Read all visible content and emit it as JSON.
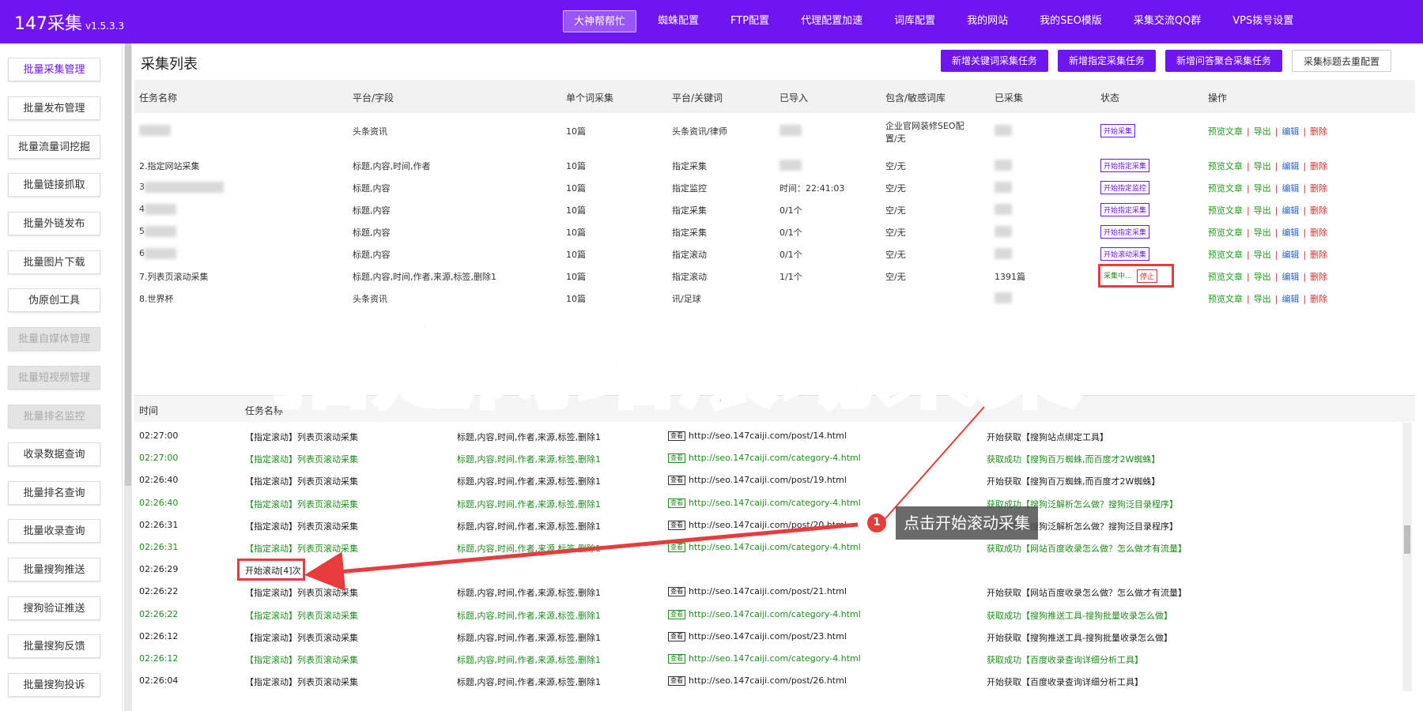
{
  "app": {
    "name": "147采集",
    "version": "v1.5.3.3"
  },
  "topnav": [
    "大神帮帮忙",
    "蜘蛛配置",
    "FTP配置",
    "代理配置加速",
    "词库配置",
    "我的网站",
    "我的SEO模版",
    "采集交流QQ群",
    "VPS拨号设置"
  ],
  "sidebar": [
    "批量采集管理",
    "批量发布管理",
    "批量流量词挖掘",
    "批量链接抓取",
    "批量外链发布",
    "批量图片下载",
    "伪原创工具",
    "批量自媒体管理",
    "批量短视频管理",
    "批量排名监控",
    "收录数据查询",
    "批量排名查询",
    "批量收录查询",
    "批量搜狗推送",
    "搜狗验证推送",
    "批量搜狗反馈",
    "批量搜狗投诉"
  ],
  "page": {
    "title": "采集列表"
  },
  "actions": [
    "新增关键词采集任务",
    "新增指定采集任务",
    "新增问答聚合采集任务",
    "采集标题去重配置"
  ],
  "table": {
    "headers": [
      "任务名称",
      "平台/字段",
      "单个词采集",
      "平台/关键词",
      "已导入",
      "包含/敏感词库",
      "已采集",
      "状态",
      "操作"
    ],
    "ops": [
      "预览文章",
      "导出",
      "编辑",
      "删除"
    ],
    "rows": [
      {
        "name": "",
        "fields": "头条资讯",
        "per": "10篇",
        "kw": "头条资讯/律师",
        "imported": "",
        "lib": "企业官网装修SEO配",
        "lib2": "置/无",
        "collected": "",
        "status": "开始采集"
      },
      {
        "name": "2.指定网站采集",
        "fields": "标题,内容,时间,作者",
        "per": "10篇",
        "kw": "指定采集",
        "imported": "",
        "lib": "空/无",
        "collected": "",
        "status": "开始指定采集"
      },
      {
        "name": "3",
        "fields": "标题,内容",
        "per": "10篇",
        "kw": "指定监控",
        "imported": "时间：22:41:03",
        "lib": "空/无",
        "collected": "",
        "status": "开始指定监控"
      },
      {
        "name": "4",
        "fields": "标题,内容",
        "per": "10篇",
        "kw": "指定采集",
        "imported": "0/1个",
        "lib": "空/无",
        "collected": "",
        "status": "开始指定采集"
      },
      {
        "name": "5",
        "fields": "标题,内容",
        "per": "10篇",
        "kw": "指定采集",
        "imported": "0/1个",
        "lib": "空/无",
        "collected": "",
        "status": "开始指定采集"
      },
      {
        "name": "6",
        "fields": "标题,内容",
        "per": "10篇",
        "kw": "指定滚动",
        "imported": "0/1个",
        "lib": "空/无",
        "collected": "",
        "status": "开始滚动采集"
      },
      {
        "name": "7.列表页滚动采集",
        "fields": "标题,内容,时间,作者,来源,标签,删除1",
        "per": "10篇",
        "kw": "指定滚动",
        "imported": "1/1个",
        "lib": "空/无",
        "collected": "1391篇",
        "status": "采集中...",
        "stop": "停止"
      },
      {
        "name": "8.世界杯",
        "fields": "头条资讯",
        "per": "10篇",
        "kw": "讯/足球",
        "imported": "",
        "lib": "",
        "collected": "",
        "status": ""
      }
    ]
  },
  "log": {
    "headers": [
      "时间",
      "任务名称"
    ],
    "badge": "查看",
    "rows": [
      {
        "time": "02:27:00",
        "green": false,
        "task": "【指定滚动】列表页滚动采集",
        "fields": "标题,内容,时间,作者,来源,标签,删除1",
        "url": "http://seo.147caiji.com/post/14.html",
        "msg": "开始获取【搜狗站点绑定工具】"
      },
      {
        "time": "02:27:00",
        "green": true,
        "task": "【指定滚动】列表页滚动采集",
        "fields": "标题,内容,时间,作者,来源,标签,删除1",
        "url": "http://seo.147caiji.com/category-4.html",
        "msg": "获取成功【搜狗百万蜘蛛,而百度才2W蜘蛛】"
      },
      {
        "time": "02:26:40",
        "green": false,
        "task": "【指定滚动】列表页滚动采集",
        "fields": "标题,内容,时间,作者,来源,标签,删除1",
        "url": "http://seo.147caiji.com/post/19.html",
        "msg": "开始获取【搜狗百万蜘蛛,而百度才2W蜘蛛】"
      },
      {
        "time": "02:26:40",
        "green": true,
        "task": "【指定滚动】列表页滚动采集",
        "fields": "标题,内容,时间,作者,来源,标签,删除1",
        "url": "http://seo.147caiji.com/category-4.html",
        "msg": "获取成功【搜狗泛解析怎么做？搜狗泛目录程序】"
      },
      {
        "time": "02:26:31",
        "green": false,
        "task": "【指定滚动】列表页滚动采集",
        "fields": "标题,内容,时间,作者,来源,标签,删除1",
        "url": "http://seo.147caiji.com/post/20.html",
        "msg": "开始获取【搜狗泛解析怎么做？搜狗泛目录程序】"
      },
      {
        "time": "02:26:31",
        "green": true,
        "task": "【指定滚动】列表页滚动采集",
        "fields": "标题,内容,时间,作者,来源,标签,删除1",
        "url": "http://seo.147caiji.com/category-4.html",
        "msg": "获取成功【网站百度收录怎么做？怎么做才有流量】"
      },
      {
        "time": "02:26:29",
        "green": false,
        "special": "开始滚动[4]次"
      },
      {
        "time": "02:26:22",
        "green": false,
        "task": "【指定滚动】列表页滚动采集",
        "fields": "标题,内容,时间,作者,来源,标签,删除1",
        "url": "http://seo.147caiji.com/post/21.html",
        "msg": "开始获取【网站百度收录怎么做？怎么做才有流量】"
      },
      {
        "time": "02:26:22",
        "green": true,
        "task": "【指定滚动】列表页滚动采集",
        "fields": "标题,内容,时间,作者,来源,标签,删除1",
        "url": "http://seo.147caiji.com/category-4.html",
        "msg": "获取成功【搜狗推送工具-搜狗批量收录怎么做】"
      },
      {
        "time": "02:26:12",
        "green": false,
        "task": "【指定滚动】列表页滚动采集",
        "fields": "标题,内容,时间,作者,来源,标签,删除1",
        "url": "http://seo.147caiji.com/post/23.html",
        "msg": "开始获取【搜狗推送工具-搜狗批量收录怎么做】"
      },
      {
        "time": "02:26:12",
        "green": true,
        "task": "【指定滚动】列表页滚动采集",
        "fields": "标题,内容,时间,作者,来源,标签,删除1",
        "url": "http://seo.147caiji.com/category-4.html",
        "msg": "获取成功【百度收录查询详细分析工具】"
      },
      {
        "time": "02:26:04",
        "green": false,
        "task": "【指定滚动】列表页滚动采集",
        "fields": "标题,内容,时间,作者,来源,标签,删除1",
        "url": "http://seo.147caiji.com/post/26.html",
        "msg": "开始获取【百度收录查询详细分析工具】"
      }
    ]
  },
  "overlay": {
    "banner": "指定网站滚动采集",
    "tip": "点击开始滚动采集",
    "tip_num": "1",
    "color": "#e83b3b"
  },
  "colors": {
    "brand": "#6f15f0",
    "ok": "#1e8e1e",
    "danger": "#e83b3b"
  }
}
